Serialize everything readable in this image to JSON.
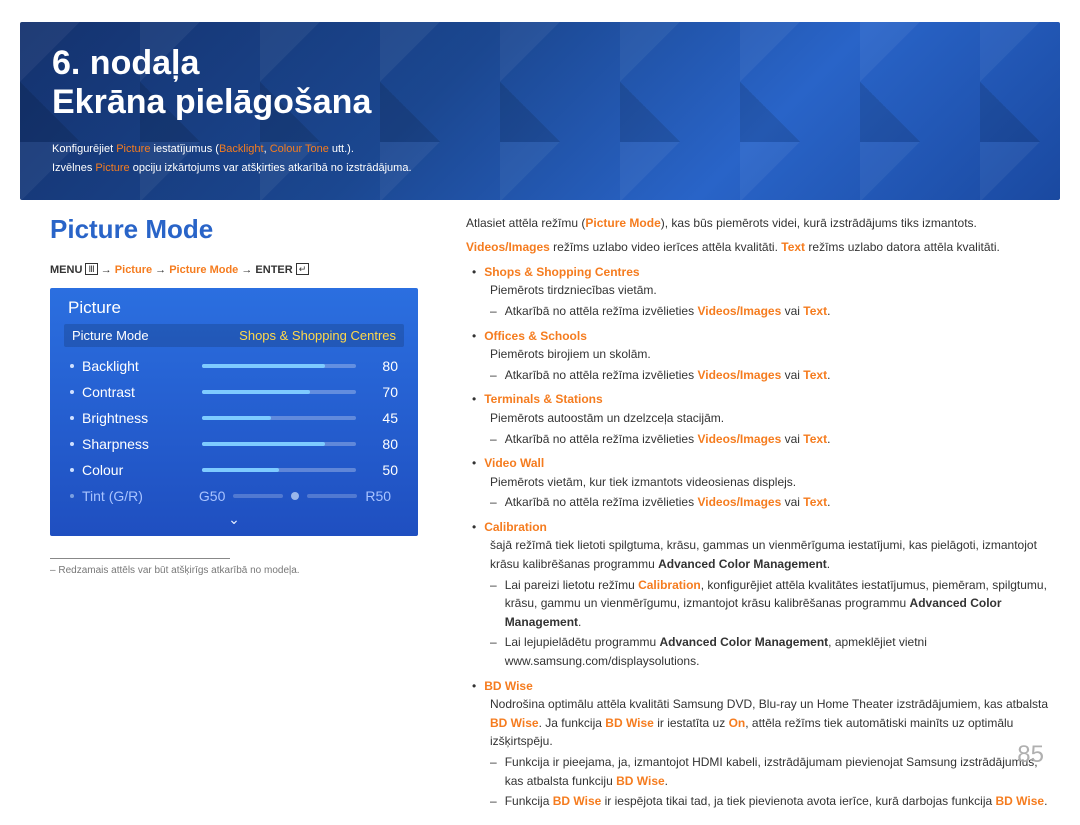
{
  "banner": {
    "chapter_line": "6. nodaļa",
    "title": "Ekrāna pielāgošana",
    "sub1_a": "Konfigurējiet ",
    "sub1_b": "Picture",
    "sub1_c": " iestatījumus (",
    "sub1_d": "Backlight",
    "sub1_e": ", ",
    "sub1_f": "Colour Tone",
    "sub1_g": " utt.).",
    "sub2_a": "Izvēlnes ",
    "sub2_b": "Picture",
    "sub2_c": " opciju izkārtojums var atšķirties atkarībā no izstrādājuma."
  },
  "left": {
    "section_title": "Picture Mode",
    "path": {
      "menu": "MENU",
      "arrow1": " → ",
      "p1": "Picture",
      "arrow2": " → ",
      "p2": "Picture Mode",
      "arrow3": " → ",
      "enter": "ENTER"
    },
    "osd": {
      "title": "Picture",
      "top_label": "Picture Mode",
      "top_value": "Shops & Shopping Centres",
      "rows": [
        {
          "label": "Backlight",
          "value": "80",
          "pct": 80
        },
        {
          "label": "Contrast",
          "value": "70",
          "pct": 70
        },
        {
          "label": "Brightness",
          "value": "45",
          "pct": 45
        },
        {
          "label": "Sharpness",
          "value": "80",
          "pct": 80
        },
        {
          "label": "Colour",
          "value": "50",
          "pct": 50
        }
      ],
      "tint_label": "Tint (G/R)",
      "tint_g": "G50",
      "tint_r": "R50"
    },
    "footnote_dash": "– ",
    "footnote": "Redzamais attēls var būt atšķirīgs atkarībā no modeļa."
  },
  "right": {
    "intro1_a": "Atlasiet attēla režīmu (",
    "intro1_b": "Picture Mode",
    "intro1_c": "), kas būs piemērots videi, kurā izstrādājums tiks izmantots.",
    "intro2_a": "Videos/Images",
    "intro2_b": " režīms uzlabo video ierīces attēla kvalitāti. ",
    "intro2_c": "Text",
    "intro2_d": " režīms uzlabo datora attēla kvalitāti.",
    "items": [
      {
        "title": "Shops & Shopping Centres",
        "desc": "Piemērots tirdzniecības vietām.",
        "dep_a": "Atkarībā no attēla režīma izvēlieties ",
        "dep_b": "Videos/Images",
        "dep_c": " vai ",
        "dep_d": "Text",
        "dep_e": "."
      },
      {
        "title": "Offices & Schools",
        "desc": "Piemērots birojiem un skolām.",
        "dep_a": "Atkarībā no attēla režīma izvēlieties ",
        "dep_b": "Videos/Images",
        "dep_c": " vai ",
        "dep_d": "Text",
        "dep_e": "."
      },
      {
        "title": "Terminals & Stations",
        "desc": "Piemērots autoostām un dzelzceļa stacijām.",
        "dep_a": "Atkarībā no attēla režīma izvēlieties ",
        "dep_b": "Videos/Images",
        "dep_c": " vai ",
        "dep_d": "Text",
        "dep_e": "."
      },
      {
        "title": "Video Wall",
        "desc": "Piemērots vietām, kur tiek izmantots videosienas displejs.",
        "dep_a": "Atkarībā no attēla režīma izvēlieties ",
        "dep_b": "Videos/Images",
        "dep_c": " vai ",
        "dep_d": "Text",
        "dep_e": "."
      }
    ],
    "calib_title": "Calibration",
    "calib_p_a": "šajā režīmā tiek lietoti spilgtuma, krāsu, gammas un vienmērīguma iestatījumi, kas pielāgoti, izmantojot krāsu kalibrēšanas programmu ",
    "calib_p_b": "Advanced Color Management",
    "calib_p_c": ".",
    "calib_d1_a": "Lai pareizi lietotu režīmu ",
    "calib_d1_b": "Calibration",
    "calib_d1_c": ", konfigurējiet attēla kvalitātes iestatījumus, piemēram, spilgtumu, krāsu, gammu un vienmērīgumu, izmantojot krāsu kalibrēšanas programmu ",
    "calib_d1_d": "Advanced Color Management",
    "calib_d1_e": ".",
    "calib_d2_a": "Lai lejupielādētu programmu ",
    "calib_d2_b": "Advanced Color Management",
    "calib_d2_c": ", apmeklējiet vietni www.samsung.com/displaysolutions.",
    "bd_title": "BD Wise",
    "bd_p1_a": "Nodrošina optimālu attēla kvalitāti Samsung DVD, Blu-ray un Home Theater izstrādājumiem, kas atbalsta ",
    "bd_p1_b": "BD Wise",
    "bd_p1_c": ". Ja funkcija ",
    "bd_p1_d": "BD Wise",
    "bd_p1_e": " ir iestatīta uz ",
    "bd_p1_f": "On",
    "bd_p1_g": ", attēla režīms tiek automātiski mainīts uz optimālu izšķirtspēju.",
    "bd_d1_a": "Funkcija ir pieejama, ja, izmantojot HDMI kabeli, izstrādājumam pievienojat Samsung izstrādājumus, kas atbalsta funkciju ",
    "bd_d1_b": "BD Wise",
    "bd_d1_c": ".",
    "bd_d2_a": "Funkcija ",
    "bd_d2_b": "BD Wise",
    "bd_d2_c": " ir iespējota tikai tad, ja tiek pievienota avota ierīce, kurā darbojas funkcija ",
    "bd_d2_d": "BD Wise",
    "bd_d2_e": "."
  },
  "page_number": "85"
}
